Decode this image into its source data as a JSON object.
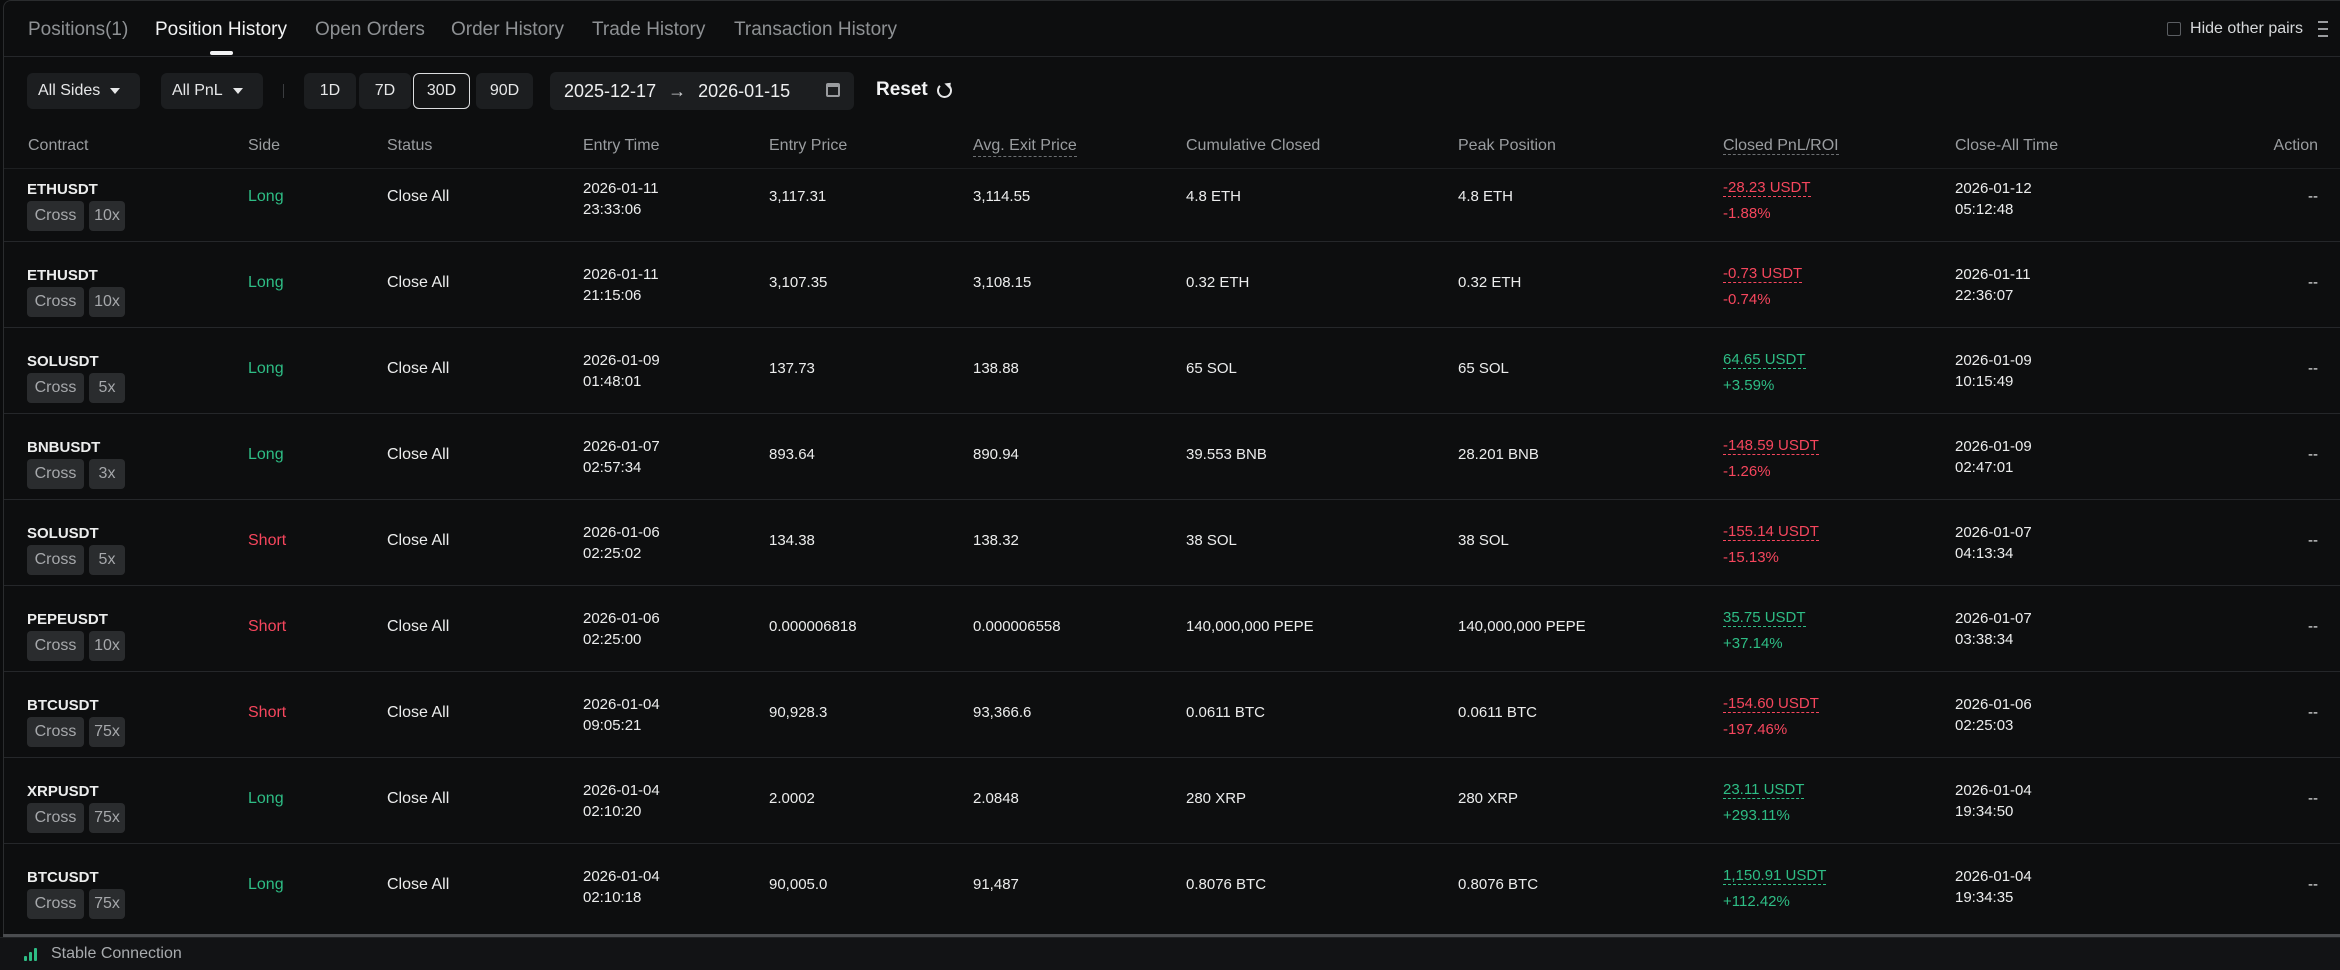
{
  "tabs": [
    {
      "label": "Positions(1)",
      "active": false
    },
    {
      "label": "Position History",
      "active": true
    },
    {
      "label": "Open Orders",
      "active": false
    },
    {
      "label": "Order History",
      "active": false
    },
    {
      "label": "Trade History",
      "active": false
    },
    {
      "label": "Transaction History",
      "active": false
    }
  ],
  "hide_other_pairs": {
    "label": "Hide other pairs",
    "checked": false
  },
  "filters": {
    "sides": "All Sides",
    "pnl": "All PnL",
    "periods": [
      "1D",
      "7D",
      "30D",
      "90D"
    ],
    "active_period": "30D",
    "date_from": "2025-12-17",
    "date_to": "2026-01-15",
    "reset_label": "Reset"
  },
  "columns": {
    "contract": "Contract",
    "side": "Side",
    "status": "Status",
    "entry_time": "Entry Time",
    "entry_price": "Entry Price",
    "exit_price": "Avg. Exit Price",
    "cumulative": "Cumulative Closed",
    "peak": "Peak Position",
    "pnl": "Closed PnL/ROI",
    "close_time": "Close-All Time",
    "action": "Action"
  },
  "rows": [
    {
      "symbol": "ETHUSDT",
      "margin": "Cross",
      "leverage": "10x",
      "side": "Long",
      "status": "Close All",
      "entry_date": "2026-01-11",
      "entry_clock": "23:33:06",
      "entry_price": "3,117.31",
      "exit_price": "3,114.55",
      "cumulative": "4.8 ETH",
      "peak": "4.8 ETH",
      "pnl": "-28.23 USDT",
      "roi": "-1.88%",
      "close_date": "2026-01-12",
      "close_clock": "05:12:48",
      "action": "--"
    },
    {
      "symbol": "ETHUSDT",
      "margin": "Cross",
      "leverage": "10x",
      "side": "Long",
      "status": "Close All",
      "entry_date": "2026-01-11",
      "entry_clock": "21:15:06",
      "entry_price": "3,107.35",
      "exit_price": "3,108.15",
      "cumulative": "0.32 ETH",
      "peak": "0.32 ETH",
      "pnl": "-0.73 USDT",
      "roi": "-0.74%",
      "close_date": "2026-01-11",
      "close_clock": "22:36:07",
      "action": "--"
    },
    {
      "symbol": "SOLUSDT",
      "margin": "Cross",
      "leverage": "5x",
      "side": "Long",
      "status": "Close All",
      "entry_date": "2026-01-09",
      "entry_clock": "01:48:01",
      "entry_price": "137.73",
      "exit_price": "138.88",
      "cumulative": "65 SOL",
      "peak": "65 SOL",
      "pnl": "64.65 USDT",
      "roi": "+3.59%",
      "close_date": "2026-01-09",
      "close_clock": "10:15:49",
      "action": "--"
    },
    {
      "symbol": "BNBUSDT",
      "margin": "Cross",
      "leverage": "3x",
      "side": "Long",
      "status": "Close All",
      "entry_date": "2026-01-07",
      "entry_clock": "02:57:34",
      "entry_price": "893.64",
      "exit_price": "890.94",
      "cumulative": "39.553 BNB",
      "peak": "28.201 BNB",
      "pnl": "-148.59 USDT",
      "roi": "-1.26%",
      "close_date": "2026-01-09",
      "close_clock": "02:47:01",
      "action": "--"
    },
    {
      "symbol": "SOLUSDT",
      "margin": "Cross",
      "leverage": "5x",
      "side": "Short",
      "status": "Close All",
      "entry_date": "2026-01-06",
      "entry_clock": "02:25:02",
      "entry_price": "134.38",
      "exit_price": "138.32",
      "cumulative": "38 SOL",
      "peak": "38 SOL",
      "pnl": "-155.14 USDT",
      "roi": "-15.13%",
      "close_date": "2026-01-07",
      "close_clock": "04:13:34",
      "action": "--"
    },
    {
      "symbol": "PEPEUSDT",
      "margin": "Cross",
      "leverage": "10x",
      "side": "Short",
      "status": "Close All",
      "entry_date": "2026-01-06",
      "entry_clock": "02:25:00",
      "entry_price": "0.000006818",
      "exit_price": "0.000006558",
      "cumulative": "140,000,000 PEPE",
      "peak": "140,000,000 PEPE",
      "pnl": "35.75 USDT",
      "roi": "+37.14%",
      "close_date": "2026-01-07",
      "close_clock": "03:38:34",
      "action": "--"
    },
    {
      "symbol": "BTCUSDT",
      "margin": "Cross",
      "leverage": "75x",
      "side": "Short",
      "status": "Close All",
      "entry_date": "2026-01-04",
      "entry_clock": "09:05:21",
      "entry_price": "90,928.3",
      "exit_price": "93,366.6",
      "cumulative": "0.0611 BTC",
      "peak": "0.0611 BTC",
      "pnl": "-154.60 USDT",
      "roi": "-197.46%",
      "close_date": "2026-01-06",
      "close_clock": "02:25:03",
      "action": "--"
    },
    {
      "symbol": "XRPUSDT",
      "margin": "Cross",
      "leverage": "75x",
      "side": "Long",
      "status": "Close All",
      "entry_date": "2026-01-04",
      "entry_clock": "02:10:20",
      "entry_price": "2.0002",
      "exit_price": "2.0848",
      "cumulative": "280 XRP",
      "peak": "280 XRP",
      "pnl": "23.11 USDT",
      "roi": "+293.11%",
      "close_date": "2026-01-04",
      "close_clock": "19:34:50",
      "action": "--"
    },
    {
      "symbol": "BTCUSDT",
      "margin": "Cross",
      "leverage": "75x",
      "side": "Long",
      "status": "Close All",
      "entry_date": "2026-01-04",
      "entry_clock": "02:10:18",
      "entry_price": "90,005.0",
      "exit_price": "91,487",
      "cumulative": "0.8076 BTC",
      "peak": "0.8076 BTC",
      "pnl": "1,150.91 USDT",
      "roi": "+112.42%",
      "close_date": "2026-01-04",
      "close_clock": "19:34:35",
      "action": "--"
    }
  ],
  "colors": {
    "long": "#2ebd85",
    "short": "#f6465d",
    "profit": "#2ebd85",
    "loss": "#f6465d"
  },
  "footer": {
    "connection": "Stable Connection",
    "icon": "signal-bars-icon"
  }
}
